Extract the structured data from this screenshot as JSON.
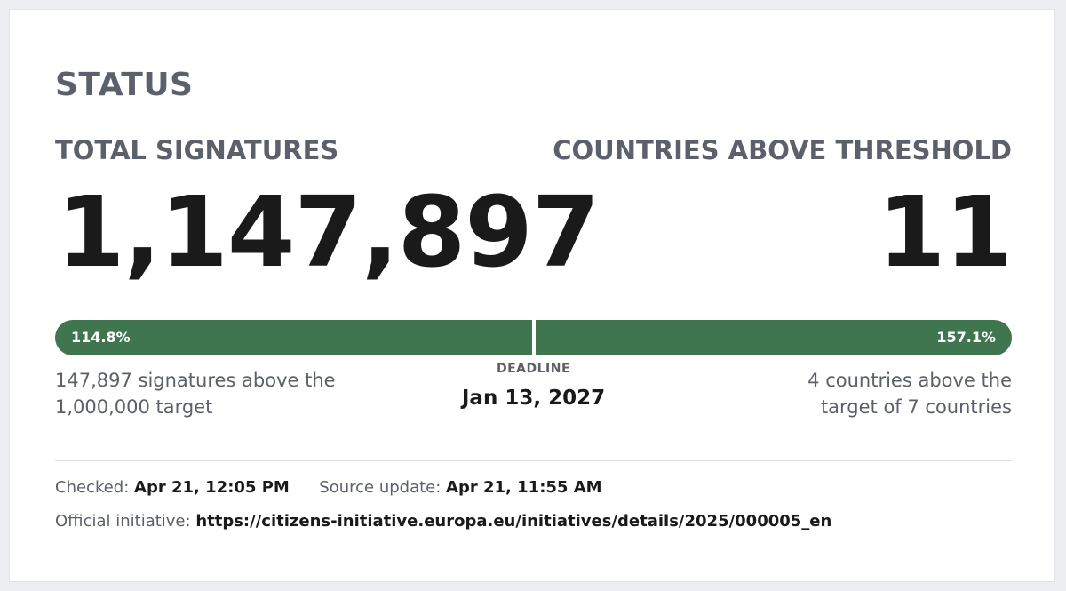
{
  "status": {
    "title": "STATUS"
  },
  "metrics": {
    "signatures": {
      "label": "TOTAL SIGNATURES",
      "value": "1,147,897",
      "progress_text": "114.8%",
      "progress_percent": 114.8,
      "note": "147,897 signatures above the 1,000,000 target"
    },
    "countries": {
      "label": "COUNTRIES ABOVE THRESHOLD",
      "value": "11",
      "progress_text": "157.1%",
      "progress_percent": 157.1,
      "note": "4 countries above the target of 7 countries"
    }
  },
  "deadline": {
    "label": "DEADLINE",
    "date": "Jan 13, 2027"
  },
  "footer": {
    "checked_label": "Checked:",
    "checked_value": "Apr 21, 12:05 PM",
    "source_label": "Source update:",
    "source_value": "Apr 21, 11:55 AM",
    "initiative_label": "Official initiative:",
    "initiative_url": "https://citizens-initiative.europa.eu/initiatives/details/2025/000005_en"
  },
  "colors": {
    "progress_bar": "#3f7650",
    "heading_text": "#5b606b",
    "value_text": "#1a1a1a"
  }
}
